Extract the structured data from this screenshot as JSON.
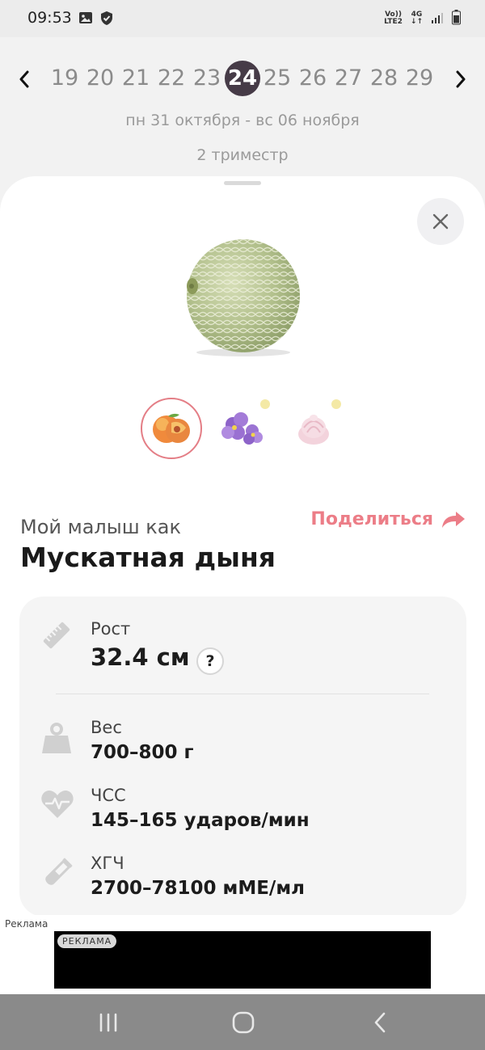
{
  "status_bar": {
    "time": "09:53",
    "network_top": "Vo))",
    "network_bottom": "LTE2",
    "signal_label": "4G",
    "icons": [
      "gallery-icon",
      "shield-icon",
      "signal-icon",
      "battery-icon"
    ]
  },
  "week_nav": {
    "weeks": [
      "19",
      "20",
      "21",
      "22",
      "23",
      "24",
      "25",
      "26",
      "27",
      "28",
      "29"
    ],
    "selected_week": "24",
    "date_range": "пн 31 октября - вс 06 ноября",
    "trimester": "2 триместр"
  },
  "comparison": {
    "thumbnails": [
      "peach",
      "violet-flower",
      "marshmallow"
    ],
    "selected_thumbnail": "peach",
    "subtitle": "Мой малыш как",
    "title": "Мускатная дыня",
    "share_label": "Поделиться"
  },
  "stats": {
    "height": {
      "label": "Рост",
      "value": "32.4 см",
      "help": "?"
    },
    "weight": {
      "label": "Вес",
      "value": "700–800 г"
    },
    "heart_rate": {
      "label": "ЧСС",
      "value": "145–165 ударов/мин"
    },
    "hcg": {
      "label": "ХГЧ",
      "value": "2700–78100 мМЕ/мл"
    }
  },
  "ad": {
    "caption": "Реклама",
    "badge": "РЕКЛАМА"
  },
  "colors": {
    "accent": "#ec7d87",
    "active_week": "#463b47",
    "card_bg": "#f5f5f5",
    "nav_bar": "#8a8a8a"
  }
}
